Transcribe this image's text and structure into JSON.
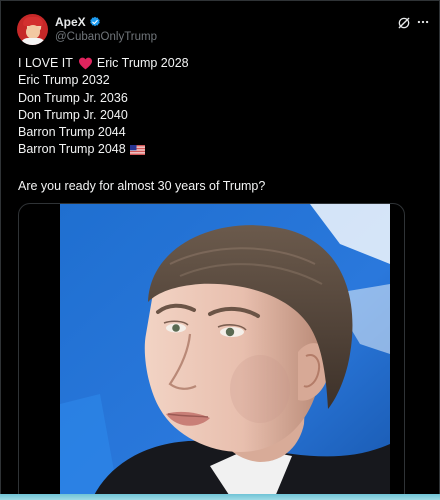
{
  "post": {
    "author": {
      "display_name": "ApeX",
      "handle": "@CubanOnlyTrump",
      "verified": true,
      "verified_color": "#1d9bf0"
    },
    "lines": [
      {
        "before": "I LOVE IT",
        "emoji": "red-heart",
        "after": "Eric Trump 2028"
      },
      {
        "text": "Eric Trump 2032"
      },
      {
        "text": "Don Trump Jr. 2036"
      },
      {
        "text": "Don Trump Jr. 2040"
      },
      {
        "text": "Barron Trump 2044"
      },
      {
        "text": "Barron Trump 2048",
        "emoji": "us-flag"
      }
    ],
    "question": "Are you ready for almost 30 years of Trump?",
    "media": {
      "type": "video",
      "background_color": "#1f6fd0"
    }
  },
  "colors": {
    "background": "#000000",
    "text": "#e7e9ea",
    "muted": "#71767b",
    "heart": "#f91880"
  }
}
